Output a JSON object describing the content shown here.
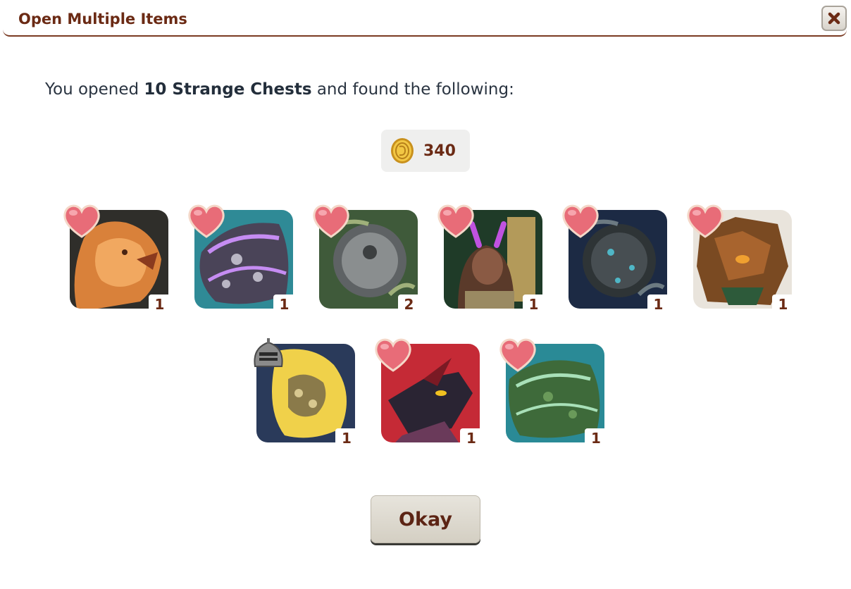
{
  "dialog": {
    "title": "Open Multiple Items",
    "close_icon": "close-x-icon"
  },
  "intro": {
    "prefix": "You opened ",
    "highlight": "10 Strange Chests",
    "suffix": " and found the following:"
  },
  "coins": {
    "icon": "gold-coin-icon",
    "amount": "340"
  },
  "items": [
    {
      "name": "lion-item",
      "qty": "1",
      "favorited": true
    },
    {
      "name": "purple-dragon-apparel",
      "qty": "1",
      "favorited": true
    },
    {
      "name": "gray-gong-item",
      "qty": "2",
      "favorited": true
    },
    {
      "name": "faun-portrait-item",
      "qty": "1",
      "favorited": true
    },
    {
      "name": "blue-gong-item",
      "qty": "1",
      "favorited": true
    },
    {
      "name": "brown-dragon-item",
      "qty": "1",
      "favorited": true
    },
    {
      "name": "yellow-dragon-apparel",
      "qty": "1",
      "favorited": false,
      "badge": "knight-helmet-icon"
    },
    {
      "name": "red-dragon-item",
      "qty": "1",
      "favorited": true
    },
    {
      "name": "green-dragon-apparel",
      "qty": "1",
      "favorited": true
    }
  ],
  "colors": {
    "title": "#6b2a14",
    "heart": "#e86c78"
  },
  "footer": {
    "okay_label": "Okay"
  }
}
